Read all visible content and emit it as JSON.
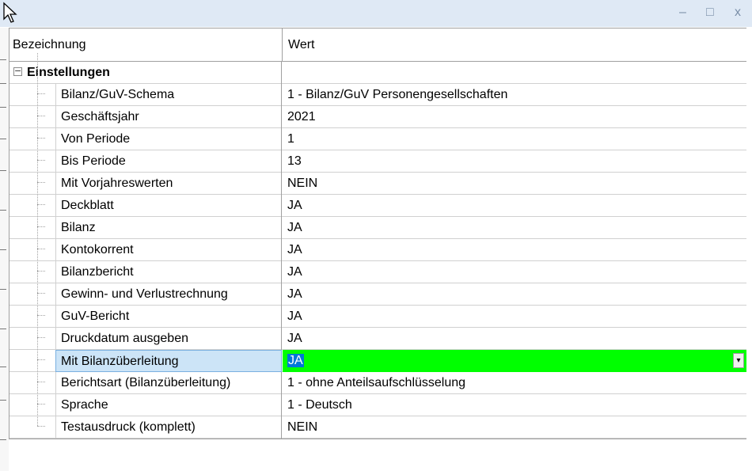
{
  "window": {
    "minimize_label": "–",
    "maximize_label": "□",
    "close_label": "x"
  },
  "grid": {
    "headers": {
      "name": "Bezeichnung",
      "value": "Wert"
    },
    "group": {
      "expander": "−",
      "label": "Einstellungen"
    },
    "rows": [
      {
        "name": "Bilanz/GuV-Schema",
        "value": "1 - Bilanz/GuV Personengesellschaften"
      },
      {
        "name": "Geschäftsjahr",
        "value": "2021"
      },
      {
        "name": "Von Periode",
        "value": "1"
      },
      {
        "name": "Bis Periode",
        "value": "13"
      },
      {
        "name": "Mit Vorjahreswerten",
        "value": "NEIN"
      },
      {
        "name": "Deckblatt",
        "value": "JA"
      },
      {
        "name": "Bilanz",
        "value": "JA"
      },
      {
        "name": "Kontokorrent",
        "value": "JA"
      },
      {
        "name": "Bilanzbericht",
        "value": "JA"
      },
      {
        "name": "Gewinn- und Verlustrechnung",
        "value": "JA"
      },
      {
        "name": "GuV-Bericht",
        "value": "JA"
      },
      {
        "name": "Druckdatum ausgeben",
        "value": "JA"
      },
      {
        "name": "Mit Bilanzüberleitung",
        "value": "JA",
        "selected": true
      },
      {
        "name": "Berichtsart (Bilanzüberleitung)",
        "value": "1 - ohne Anteilsaufschlüsselung"
      },
      {
        "name": "Sprache",
        "value": "1 - Deutsch"
      },
      {
        "name": "Testausdruck (komplett)",
        "value": "NEIN"
      }
    ],
    "dropdown_icon": "▾"
  },
  "colors": {
    "selected_value_bg": "#00ff00",
    "selected_name_bg": "#cce4f7",
    "titlebar_bg": "#dfe9f5"
  }
}
